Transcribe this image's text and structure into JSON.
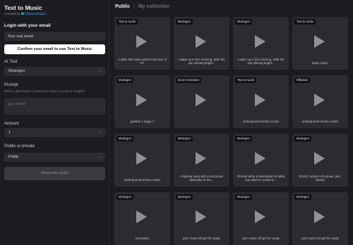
{
  "app": {
    "title": "Text to Music",
    "credit_prefix": "Created by",
    "credit_handle": "@fatimikhajee..."
  },
  "login": {
    "title": "Login with your email",
    "email_placeholder": "Your real email",
    "confirm_label": "Confirm your email to use Text to Music"
  },
  "ai_tool": {
    "label": "AI Tool",
    "value": "Musicgen"
  },
  "prompt": {
    "label": "Prompt",
    "hint": "Write a description of what you want to create in English",
    "placeholder": "jazz music"
  },
  "amount": {
    "label": "Amount",
    "value": "1"
  },
  "visibility": {
    "label": "Public or private",
    "value": "Public"
  },
  "generate_label": "Generate audio",
  "tabs": {
    "public": "Public",
    "separator": "|",
    "mine": "My collection"
  },
  "cards": [
    {
      "badge": "Text to Audio",
      "caption": "A dark, 80s style synth in the key of F#."
    },
    {
      "badge": "Musicgen",
      "caption": "I wake up in the morning, With the sun shining bright..."
    },
    {
      "badge": "Musicgen",
      "caption": "I wake up in the morning, With the sun shining bright..."
    },
    {
      "badge": "Text to Audio",
      "caption": "Bass music"
    },
    {
      "badge": "Musicgen",
      "caption": "gradius 1 stage 1"
    },
    {
      "badge": "Drum Generator",
      "caption": ""
    },
    {
      "badge": "Text to Audio",
      "caption": "underground techno music"
    },
    {
      "badge": "Riffusion",
      "caption": "underground techno music"
    },
    {
      "badge": "Musicgen",
      "caption": "underground techno music"
    },
    {
      "badge": "Musicgen",
      "caption": "A hiphop song with a moroccan darbouka in the..."
    },
    {
      "badge": "Musicgen",
      "caption": "Prompt Write a description of what you want to create in..."
    },
    {
      "badge": "Musicgen",
      "caption": "SOAD, system of a down, jazz, classic"
    },
    {
      "badge": "Musicgen",
      "caption": "rammstein"
    },
    {
      "badge": "Musicgen",
      "caption": "jazz music lofi girl for study"
    },
    {
      "badge": "Musicgen",
      "caption": "jazz music lofi girl for study"
    },
    {
      "badge": "Musicgen",
      "caption": "jazz music lofi girl for study"
    }
  ]
}
